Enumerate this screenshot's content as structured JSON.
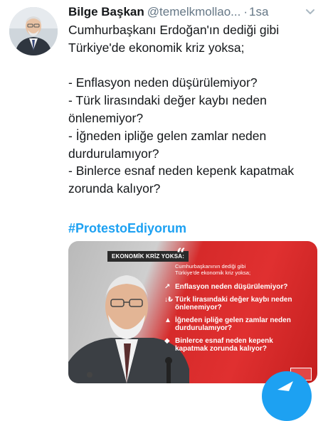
{
  "tweet": {
    "display_name": "Bilge Başkan",
    "handle": "@temelkmollao...",
    "separator": "·",
    "time": "1sa",
    "lines": [
      "Cumhurbaşkanı Erdoğan'ın dediği gibi",
      "Türkiye'de ekonomik kriz yoksa;",
      "",
      "- Enflasyon neden düşürülemiyor?",
      "- Türk lirasındaki değer kaybı neden",
      "önlenemiyor?",
      "- İğneden ipliğe gelen zamlar neden",
      "durdurulamıyor?",
      "- Binlerce esnaf neden kepenk kapatmak",
      "zorunda kalıyor?"
    ],
    "hashtag": "#ProtestoEdiyorum"
  },
  "card": {
    "banner": "EKONOMİK KRİZ YOKSA:",
    "quote_mark": "“",
    "intro_1": "Cumhurbaşkanının dediği gibi",
    "intro_2": "Türkiye'de ekonomik kriz yoksa;",
    "items": [
      {
        "icon": "chart-up-icon",
        "glyph": "↗",
        "line1": "Enflasyon neden düşürülemiyor?",
        "line2": ""
      },
      {
        "icon": "lira-down-icon",
        "glyph": "↓₺",
        "line1": "Türk lirasındaki değer kaybı neden",
        "line2": "önlenemiyor?"
      },
      {
        "icon": "price-tag-icon",
        "glyph": "▲",
        "line1": "İğneden ipliğe gelen zamlar neden",
        "line2": "durdurulamıyor?"
      },
      {
        "icon": "shop-icon",
        "glyph": "◆",
        "line1": "Binlerce esnaf neden kepenk",
        "line2": "kapatmak zorunda kalıyor?"
      }
    ]
  },
  "colors": {
    "link": "#1da1f2",
    "text": "#14171a",
    "muted": "#657786",
    "card_red": "#e03030"
  },
  "icons": {
    "menu": "chevron-down-icon",
    "compose": "compose-tweet-icon"
  }
}
